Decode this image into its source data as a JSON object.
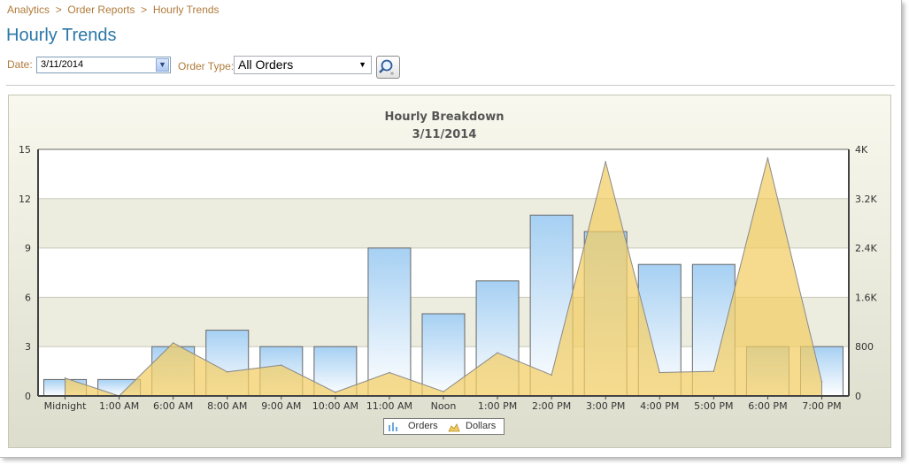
{
  "breadcrumb": {
    "items": [
      "Analytics",
      "Order Reports",
      "Hourly Trends"
    ],
    "separator": ">"
  },
  "page_title": "Hourly Trends",
  "filters": {
    "date_label": "Date:",
    "date_value": "3/11/2014",
    "order_type_label": "Order Type:",
    "order_type_value": "All Orders",
    "search_icon": "magnifier-icon"
  },
  "colors": {
    "bar_top": "#a6d0f3",
    "bar_bottom": "#ffffff",
    "bar_stroke": "#666666",
    "area_fill": "#f3cd62",
    "area_stroke": "#8a8a8a",
    "link": "#b07a3a",
    "title": "#2a77a8"
  },
  "chart_data": {
    "type": "bar",
    "title": "Hourly Breakdown",
    "subtitle": "3/11/2014",
    "categories": [
      "Midnight",
      "1:00 AM",
      "6:00 AM",
      "8:00 AM",
      "9:00 AM",
      "10:00 AM",
      "11:00 AM",
      "Noon",
      "1:00 PM",
      "2:00 PM",
      "3:00 PM",
      "4:00 PM",
      "5:00 PM",
      "6:00 PM",
      "7:00 PM"
    ],
    "series": [
      {
        "name": "Orders",
        "type": "bar",
        "axis": "left",
        "values": [
          1,
          1,
          3,
          4,
          3,
          3,
          9,
          5,
          7,
          11,
          10,
          8,
          8,
          3,
          3
        ]
      },
      {
        "name": "Dollars",
        "type": "area",
        "axis": "right",
        "values": [
          290,
          0,
          860,
          390,
          500,
          60,
          380,
          70,
          700,
          340,
          3800,
          380,
          400,
          3860,
          230
        ]
      }
    ],
    "y_left": {
      "min": 0,
      "max": 15,
      "ticks": [
        "0",
        "3",
        "6",
        "9",
        "12",
        "15"
      ]
    },
    "y_right": {
      "min": 0,
      "max": 4000,
      "ticks": [
        "0",
        "800",
        "1.6K",
        "2.4K",
        "3.2K",
        "4K"
      ]
    },
    "legend": {
      "position": "bottom",
      "entries": [
        "Orders",
        "Dollars"
      ]
    },
    "grid": true
  }
}
